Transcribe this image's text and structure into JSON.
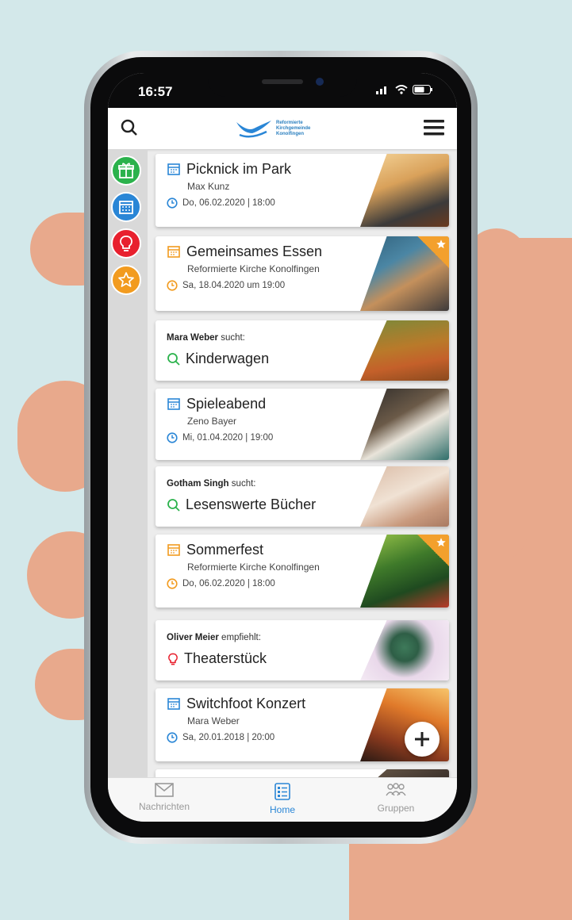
{
  "status_bar": {
    "time": "16:57"
  },
  "header": {
    "logo_lines": [
      "Reformierte",
      "Kirchgemeinde",
      "Konolfingen"
    ],
    "search_icon": "search-icon",
    "menu_icon": "hamburger-menu-icon"
  },
  "categories": [
    {
      "icon": "gift-icon",
      "color": "#2bb24c"
    },
    {
      "icon": "calendar-icon",
      "color": "#2a86d6"
    },
    {
      "icon": "lightbulb-icon",
      "color": "#e8202e"
    },
    {
      "icon": "star-icon",
      "color": "#f29b1f"
    }
  ],
  "feed": [
    {
      "kind": "event",
      "title": "Picknick im Park",
      "subtitle": "Max Kunz",
      "date": "Do, 06.02.2020 | 18:00",
      "accent": "#2a86d6",
      "featured": false
    },
    {
      "kind": "event",
      "title": "Gemeinsames Essen",
      "subtitle": "Reformierte Kirche Konolfingen",
      "date": "Sa, 18.04.2020 um 19:00",
      "accent": "#f29b1f",
      "featured": true
    },
    {
      "kind": "search",
      "person": "Mara Weber",
      "verb": "sucht:",
      "title": "Kinderwagen",
      "accent": "#2bb24c"
    },
    {
      "kind": "event",
      "title": "Spieleabend",
      "subtitle": "Zeno Bayer",
      "date": "Mi, 01.04.2020 | 19:00",
      "accent": "#2a86d6",
      "featured": false
    },
    {
      "kind": "search",
      "person": "Gotham Singh",
      "verb": "sucht:",
      "title": "Lesenswerte Bücher",
      "accent": "#2bb24c"
    },
    {
      "kind": "event",
      "title": "Sommerfest",
      "subtitle": "Reformierte Kirche Konolfingen",
      "date": "Do, 06.02.2020 | 18:00",
      "accent": "#f29b1f",
      "featured": true
    },
    {
      "kind": "recommend",
      "person": "Oliver Meier",
      "verb": "empfiehlt:",
      "title": "Theaterstück",
      "accent": "#e8202e"
    },
    {
      "kind": "event",
      "title": "Switchfoot Konzert",
      "subtitle": "Mara Weber",
      "date": "Sa, 20.01.2018 | 20:00",
      "accent": "#2a86d6",
      "featured": false
    }
  ],
  "tabs": [
    {
      "label": "Nachrichten",
      "icon": "envelope-icon",
      "active": false
    },
    {
      "label": "Home",
      "icon": "list-icon",
      "active": true
    },
    {
      "label": "Gruppen",
      "icon": "group-icon",
      "active": false
    }
  ],
  "colors": {
    "accent_blue": "#2a86d6",
    "accent_orange": "#f29b1f",
    "accent_green": "#2bb24c",
    "accent_red": "#e8202e"
  }
}
